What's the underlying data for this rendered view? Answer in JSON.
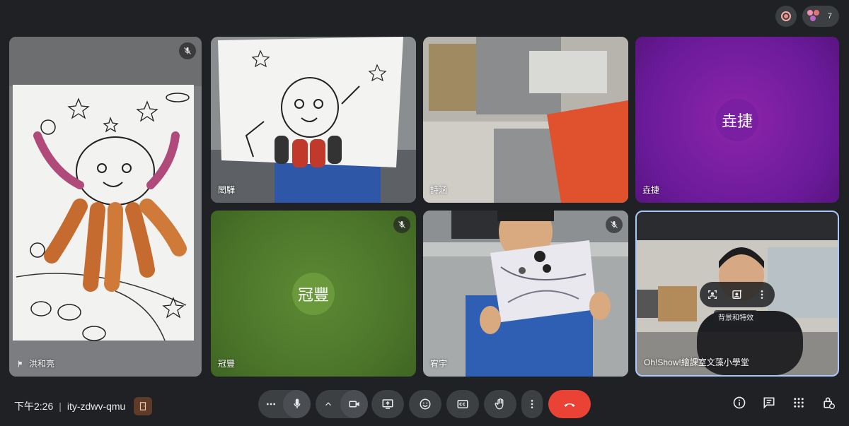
{
  "meeting": {
    "time": "下午2:26",
    "separator": "|",
    "code": "ity-zdwv-qmu"
  },
  "top": {
    "participant_count": "7"
  },
  "tiles": [
    {
      "name": "洪和亮",
      "muted": true,
      "content": "drawing-octopus"
    },
    {
      "name": "閎驊",
      "muted": false,
      "content": "drawing-octopus-2"
    },
    {
      "name": "詩涵",
      "muted": false,
      "content": "camera-room"
    },
    {
      "name": "垚捷",
      "muted": false,
      "content": "avatar",
      "initials": "垚捷",
      "bg": "#7b1fa2"
    },
    {
      "name": "冠豐",
      "muted": true,
      "content": "avatar",
      "initials": "冠豐",
      "bg": "#4d7a2b"
    },
    {
      "name": "宥宇",
      "muted": true,
      "content": "child-holding-drawing"
    },
    {
      "name": "Oh!Show!繪課室文藻小學堂",
      "muted": false,
      "content": "self-view"
    }
  ],
  "self_view": {
    "tooltip": "背景和特效"
  },
  "colors": {
    "background": "#202124",
    "control": "#3c4043",
    "end_call": "#ea4335",
    "self_border": "#a8c7fa"
  },
  "icons": {
    "controls": [
      "more-options-icon",
      "mic-icon",
      "chevron-up-icon",
      "camera-icon",
      "present-icon",
      "emoji-icon",
      "captions-icon",
      "raise-hand-icon",
      "more-vert-icon",
      "end-call-icon"
    ],
    "right": [
      "info-icon",
      "chat-icon",
      "apps-icon",
      "host-controls-icon"
    ]
  }
}
